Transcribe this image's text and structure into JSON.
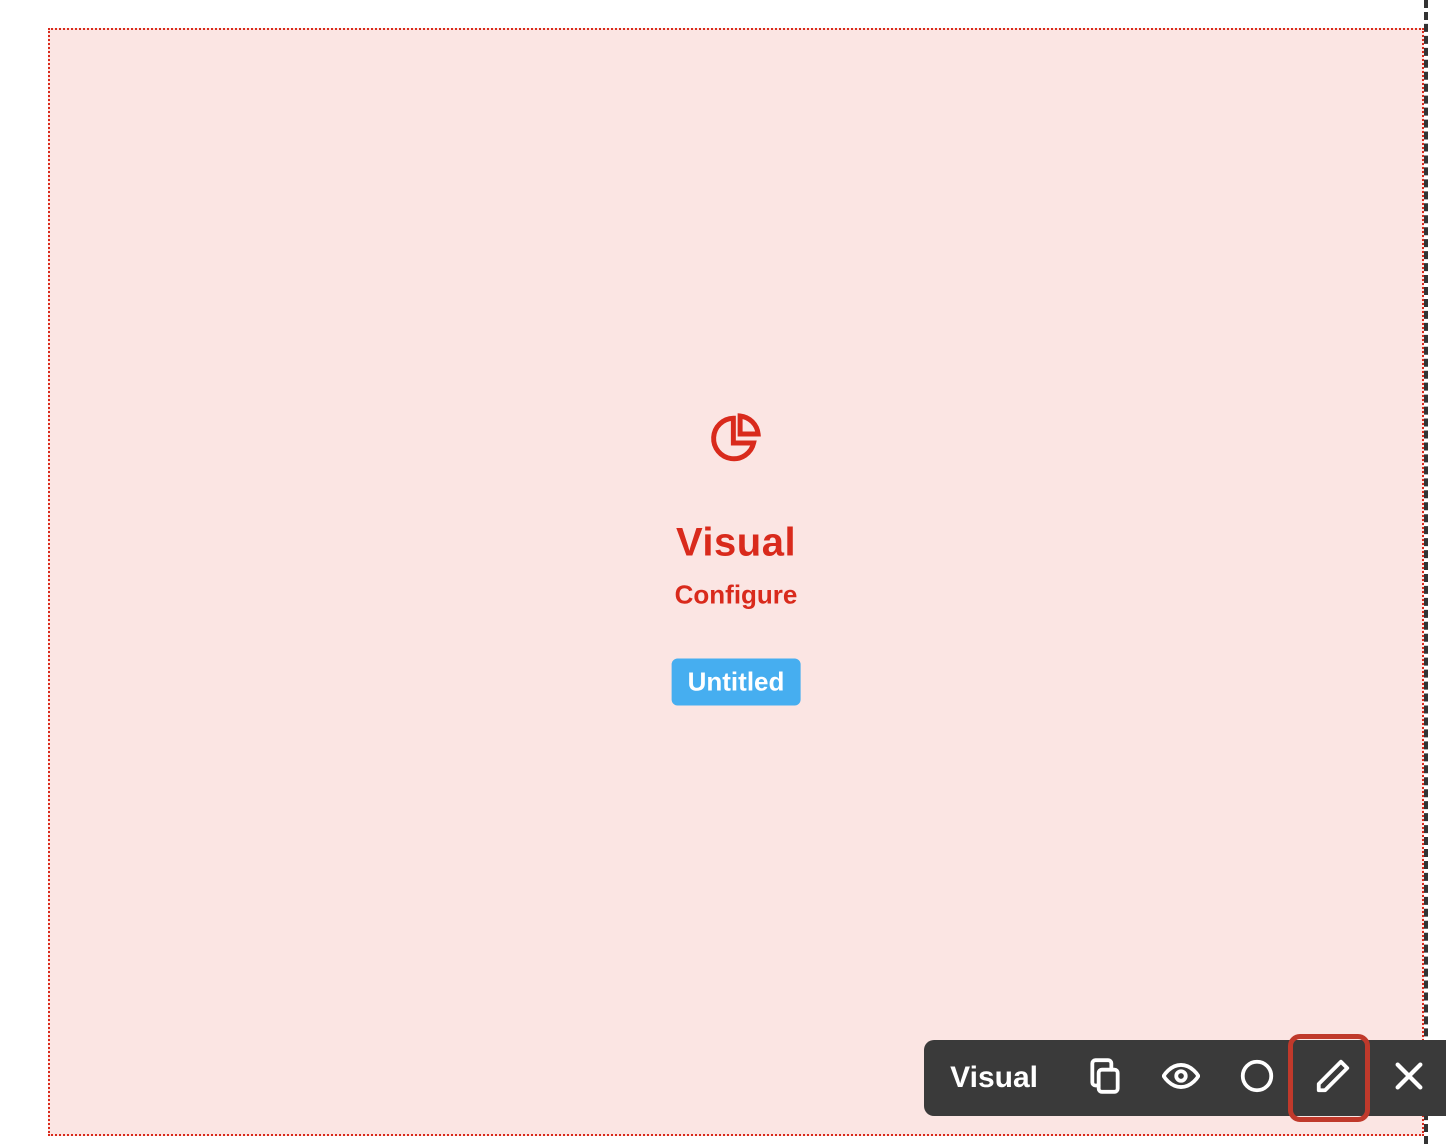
{
  "block": {
    "icon": "pie-chart-icon",
    "title": "Visual",
    "configure_label": "Configure",
    "name_badge": "Untitled"
  },
  "toolbar": {
    "label": "Visual",
    "buttons": {
      "duplicate": "duplicate-icon",
      "preview": "eye-icon",
      "status": "circle-icon",
      "edit": "pencil-icon",
      "close": "close-icon"
    },
    "highlighted": "edit"
  },
  "colors": {
    "accent": "#d92a1c",
    "block_bg": "#fbe5e3",
    "badge_bg": "#46aef0",
    "toolbar_bg": "#3a3a3a",
    "highlight": "#c0392b"
  }
}
